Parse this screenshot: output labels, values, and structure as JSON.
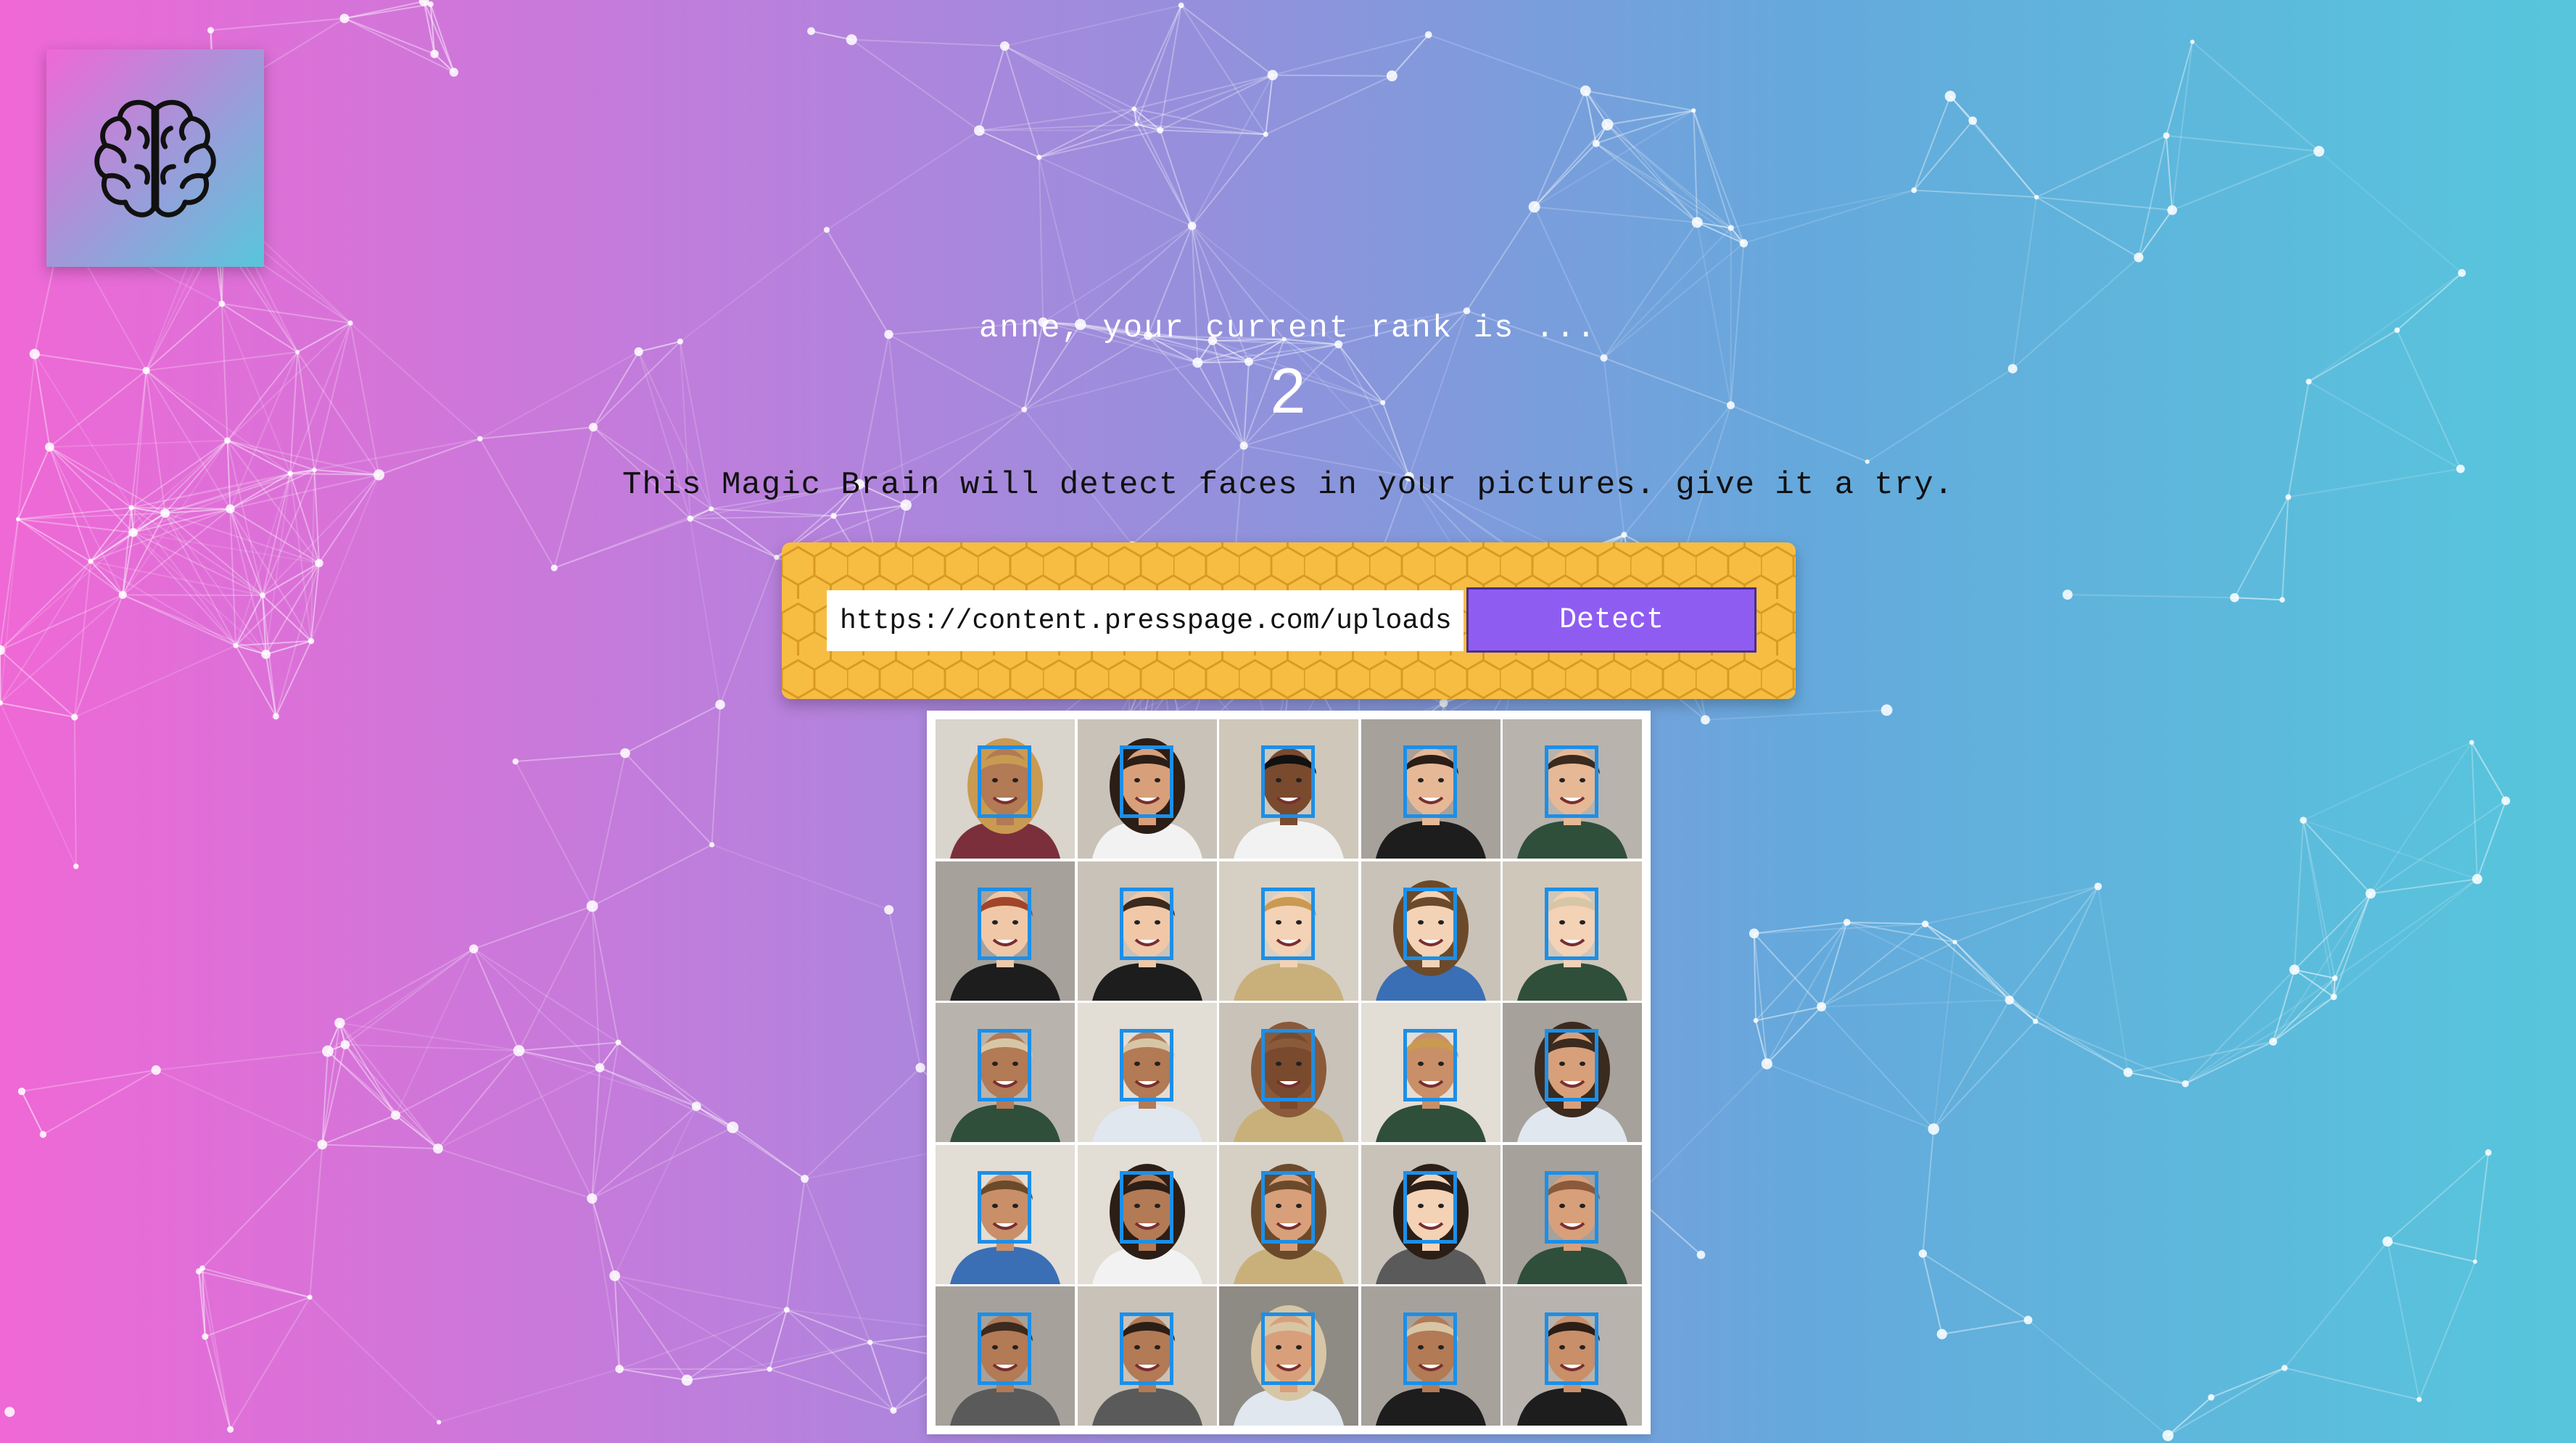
{
  "app": {
    "logo_icon": "brain-icon",
    "background_colors": [
      "#ef68d6",
      "#57c6dc"
    ]
  },
  "rank": {
    "message": "anne, your current rank is ...",
    "value": "2"
  },
  "intro_text": "This Magic Brain will detect faces in your pictures. give it a try.",
  "form": {
    "url_value": "https://content.presspage.com/uploads/",
    "detect_label": "Detect",
    "panel_color": "#f6bd42",
    "button_color": "#8f5cf2"
  },
  "result": {
    "image_description_icon": "face-grid-photo",
    "rows": 5,
    "columns": 5,
    "faces_detected": 25,
    "box_color": "#1c8fe8"
  }
}
